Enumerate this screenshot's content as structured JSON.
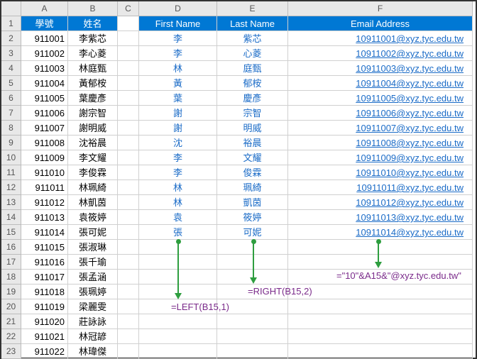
{
  "columns": [
    "A",
    "B",
    "C",
    "D",
    "E",
    "F"
  ],
  "row_numbers": [
    1,
    2,
    3,
    4,
    5,
    6,
    7,
    8,
    9,
    10,
    11,
    12,
    13,
    14,
    15,
    16,
    17,
    18,
    19,
    20,
    21,
    22,
    23
  ],
  "headers": {
    "A": "學號",
    "B": "姓名",
    "D": "First Name",
    "E": "Last Name",
    "F": "Email Address"
  },
  "rows": [
    {
      "a": "911001",
      "b": "李紫芯",
      "d": "李",
      "e": "紫芯",
      "f": "10911001@xyz.tyc.edu.tw"
    },
    {
      "a": "911002",
      "b": "李心菱",
      "d": "李",
      "e": "心菱",
      "f": "10911002@xyz.tyc.edu.tw"
    },
    {
      "a": "911003",
      "b": "林庭甄",
      "d": "林",
      "e": "庭甄",
      "f": "10911003@xyz.tyc.edu.tw"
    },
    {
      "a": "911004",
      "b": "黃郁桉",
      "d": "黃",
      "e": "郁桉",
      "f": "10911004@xyz.tyc.edu.tw"
    },
    {
      "a": "911005",
      "b": "葉慶彥",
      "d": "葉",
      "e": "慶彥",
      "f": "10911005@xyz.tyc.edu.tw"
    },
    {
      "a": "911006",
      "b": "謝宗智",
      "d": "謝",
      "e": "宗智",
      "f": "10911006@xyz.tyc.edu.tw"
    },
    {
      "a": "911007",
      "b": "謝明威",
      "d": "謝",
      "e": "明威",
      "f": "10911007@xyz.tyc.edu.tw"
    },
    {
      "a": "911008",
      "b": "沈裕晨",
      "d": "沈",
      "e": "裕晨",
      "f": "10911008@xyz.tyc.edu.tw"
    },
    {
      "a": "911009",
      "b": "李文耀",
      "d": "李",
      "e": "文耀",
      "f": "10911009@xyz.tyc.edu.tw"
    },
    {
      "a": "911010",
      "b": "李俊霖",
      "d": "李",
      "e": "俊霖",
      "f": "10911010@xyz.tyc.edu.tw"
    },
    {
      "a": "911011",
      "b": "林珮綺",
      "d": "林",
      "e": "珮綺",
      "f": "10911011@xyz.tyc.edu.tw"
    },
    {
      "a": "911012",
      "b": "林凱茵",
      "d": "林",
      "e": "凱茵",
      "f": "10911012@xyz.tyc.edu.tw"
    },
    {
      "a": "911013",
      "b": "袁筱婷",
      "d": "袁",
      "e": "筱婷",
      "f": "10911013@xyz.tyc.edu.tw"
    },
    {
      "a": "911014",
      "b": "張可妮",
      "d": "張",
      "e": "可妮",
      "f": "10911014@xyz.tyc.edu.tw"
    },
    {
      "a": "911015",
      "b": "張淑琳",
      "d": "",
      "e": "",
      "f": ""
    },
    {
      "a": "911016",
      "b": "張千瑜",
      "d": "",
      "e": "",
      "f": ""
    },
    {
      "a": "911017",
      "b": "張孟涵",
      "d": "",
      "e": "",
      "f": ""
    },
    {
      "a": "911018",
      "b": "張珮婷",
      "d": "",
      "e": "",
      "f": ""
    },
    {
      "a": "911019",
      "b": "梁麗雯",
      "d": "",
      "e": "",
      "f": ""
    },
    {
      "a": "911020",
      "b": "莊詠詠",
      "d": "",
      "e": "",
      "f": ""
    },
    {
      "a": "911021",
      "b": "林冠諺",
      "d": "",
      "e": "",
      "f": ""
    },
    {
      "a": "911022",
      "b": "林瑋傑",
      "d": "",
      "e": "",
      "f": ""
    }
  ],
  "annotations": {
    "formula_d": "=LEFT(B15,1)",
    "formula_e": "=RIGHT(B15,2)",
    "formula_f": "=\"10\"&A15&\"@xyz.tyc.edu.tw\""
  }
}
